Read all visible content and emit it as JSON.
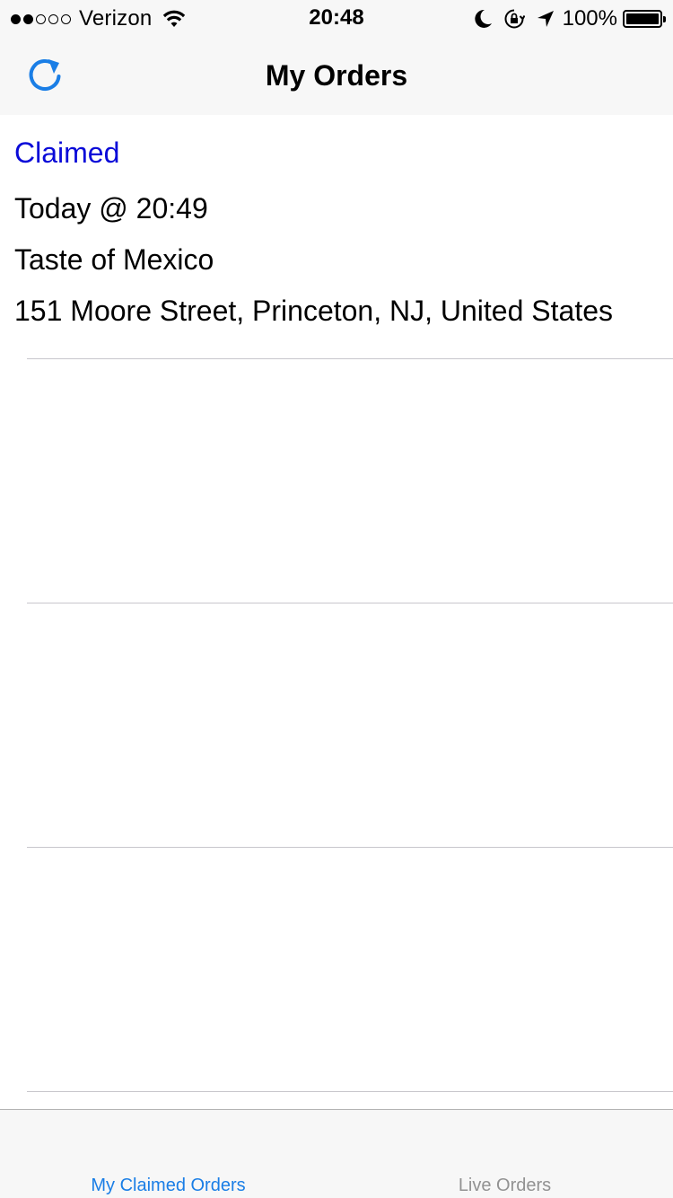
{
  "status_bar": {
    "carrier": "Verizon",
    "time": "20:48",
    "battery_percent": "100%",
    "signal_strength": 2,
    "signal_max": 5,
    "icons": [
      "wifi-icon",
      "moon-icon",
      "rotation-lock-icon",
      "location-arrow-icon",
      "battery-icon"
    ]
  },
  "nav": {
    "title": "My Orders",
    "left_icon": "refresh-icon"
  },
  "orders": [
    {
      "status": "Claimed",
      "time": "Today @ 20:49",
      "restaurant": "Taste of Mexico",
      "address": "151 Moore Street, Princeton, NJ, United States"
    }
  ],
  "tabs": [
    {
      "label": "My Claimed Orders",
      "active": true
    },
    {
      "label": "Live Orders",
      "active": false
    }
  ],
  "colors": {
    "accent": "#1a7ee6",
    "status_claimed": "#0a0ad8",
    "bar_background": "#f7f7f7",
    "separator": "#c8c7cc",
    "tab_inactive": "#929292"
  }
}
